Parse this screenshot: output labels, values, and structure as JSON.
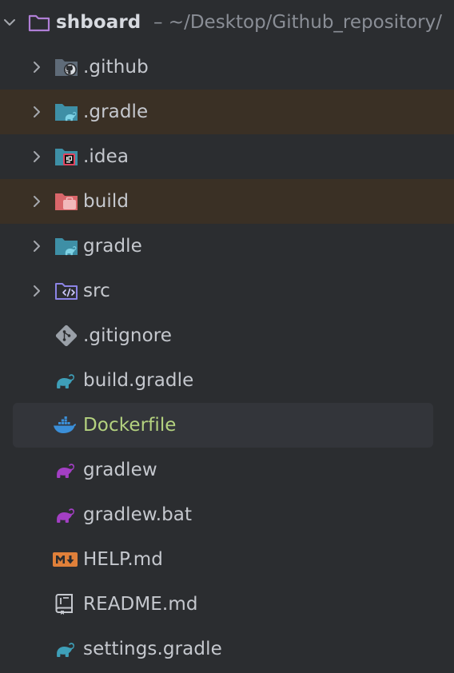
{
  "root": {
    "name": "shboard",
    "path": "– ~/Desktop/Github_repository/"
  },
  "items": [
    {
      "label": ".github",
      "icon": "github-folder-icon"
    },
    {
      "label": ".gradle",
      "icon": "gradle-folder-icon"
    },
    {
      "label": ".idea",
      "icon": "idea-folder-icon"
    },
    {
      "label": "build",
      "icon": "build-folder-icon"
    },
    {
      "label": "gradle",
      "icon": "gradle-folder-icon"
    },
    {
      "label": "src",
      "icon": "source-folder-icon"
    },
    {
      "label": ".gitignore",
      "icon": "git-diamond-icon"
    },
    {
      "label": "build.gradle",
      "icon": "gradle-elephant-icon"
    },
    {
      "label": "Dockerfile",
      "icon": "docker-whale-icon"
    },
    {
      "label": "gradlew",
      "icon": "gradle-elephant-purple-icon"
    },
    {
      "label": "gradlew.bat",
      "icon": "gradle-elephant-purple-icon"
    },
    {
      "label": "HELP.md",
      "icon": "markdown-icon"
    },
    {
      "label": "README.md",
      "icon": "readme-book-icon"
    },
    {
      "label": "settings.gradle",
      "icon": "gradle-elephant-icon"
    }
  ],
  "colors": {
    "background": "#2b2d30",
    "excluded_row": "#3a3025",
    "selected_row": "#33353a",
    "text": "#c5c8ce",
    "dockerfile_text": "#b4d27f",
    "gradle_blue": "#3e9fb8",
    "gradle_purple": "#a040c0"
  }
}
